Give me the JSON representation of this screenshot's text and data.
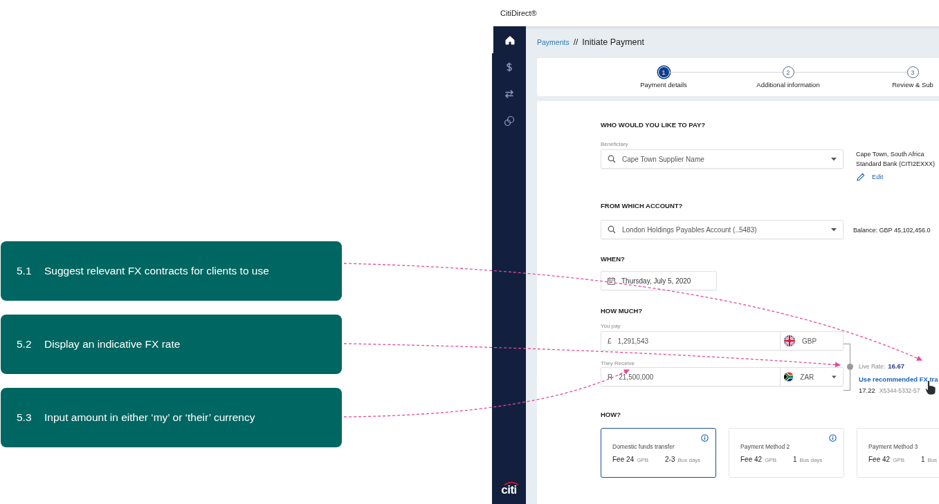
{
  "annotations": [
    {
      "number": "5.1",
      "text": "Suggest relevant FX contracts for clients to use"
    },
    {
      "number": "5.2",
      "text": "Display an indicative FX rate"
    },
    {
      "number": "5.3",
      "text": "Input amount in either ‘my’ or ‘their’ currency"
    }
  ],
  "app_title": "CitiDirect®",
  "sidebar": {
    "items": [
      {
        "kind": "home",
        "selected": true
      },
      {
        "kind": "dollar",
        "selected": false
      },
      {
        "kind": "transfer",
        "selected": false
      },
      {
        "kind": "coins",
        "selected": false
      }
    ],
    "logo": "citi"
  },
  "breadcrumb": {
    "link": "Payments",
    "separator": "//",
    "current": "Initiate Payment"
  },
  "steps": [
    {
      "number": "1",
      "label": "Payment details",
      "selected": true
    },
    {
      "number": "2",
      "label": "Additional information",
      "selected": false
    },
    {
      "number": "3",
      "label": "Review & Sub",
      "selected": false
    }
  ],
  "beneficiary": {
    "heading": "WHO WOULD YOU LIKE TO PAY?",
    "label": "Beneficiary",
    "value": "Cape Town Supplier Name",
    "details": [
      "Cape Town, South Africa",
      "Standard Bank (CITI2EXXX)"
    ],
    "edit": "Edit"
  },
  "account": {
    "heading": "FROM WHICH ACCOUNT?",
    "value": "London Holdings Payables Account (..5483)",
    "balance_label": "Balance:",
    "balance": "GBP 45,102,456.0"
  },
  "when": {
    "heading": "WHEN?",
    "value": "Thursday, July 5, 2020"
  },
  "how_much": {
    "heading": "HOW MUCH?",
    "rows": [
      {
        "label": "You pay",
        "symbol": "£",
        "value": "1,291,543",
        "currency": "GBP",
        "kind": "uk",
        "dropdown": false
      },
      {
        "label": "They Receive",
        "symbol": "R",
        "value": "21,500,000",
        "currency": "ZAR",
        "kind": "za",
        "dropdown": true
      }
    ],
    "rate_label": "Live Rate:",
    "rate": "16.67",
    "recommend_link": "Use recommended FX tra",
    "contract_rate": "17.22",
    "contract_id": "X5344-5332-57"
  },
  "how": {
    "heading": "HOW?",
    "methods": [
      {
        "name": "Domestic funds transfer",
        "fee": "Fee 24",
        "fee_currency": "GPB",
        "days": "2-3",
        "days_unit": "Bus days",
        "selected": true,
        "info": true
      },
      {
        "name": "Payment Method 2",
        "fee": "Fee 42",
        "fee_currency": "GPB",
        "days": "1",
        "days_unit": "Bus days",
        "selected": false,
        "info": true
      },
      {
        "name": "Payment Method 3",
        "fee": "Fee 42",
        "fee_currency": "GPB",
        "days": "1",
        "days_unit": "Bus",
        "selected": false,
        "info": false
      }
    ]
  }
}
